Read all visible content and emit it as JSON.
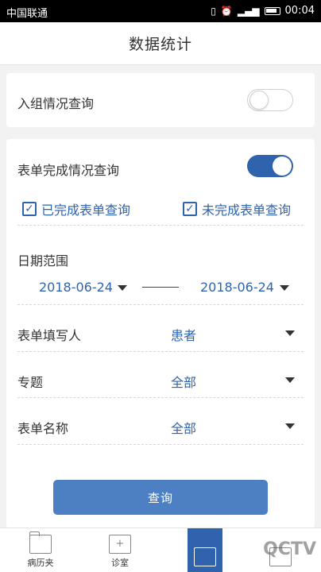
{
  "statusbar": {
    "carrier": "中国联通",
    "time": "00:04"
  },
  "header": {
    "title": "数据统计"
  },
  "group_query": {
    "label": "入组情况查询",
    "toggle_on": false
  },
  "form_query": {
    "label": "表单完成情况查询",
    "toggle_on": true,
    "completed": {
      "label": "已完成表单查询",
      "checked": true
    },
    "uncompleted": {
      "label": "未完成表单查询",
      "checked": true
    },
    "date_range": {
      "label": "日期范围",
      "start": "2018-06-24",
      "end": "2018-06-24"
    },
    "filler": {
      "label": "表单填写人",
      "value": "患者"
    },
    "topic": {
      "label": "专题",
      "value": "全部"
    },
    "form_name": {
      "label": "表单名称",
      "value": "全部"
    },
    "query_button": "查询"
  },
  "tabbar": {
    "tabs": [
      {
        "label": "病历夹"
      },
      {
        "label": "诊室"
      },
      {
        "label": ""
      },
      {
        "label": ""
      }
    ],
    "watermark": "QCTV"
  },
  "colors": {
    "accent": "#2f63ae",
    "button": "#4d80c2",
    "background": "#f2f2f2"
  }
}
